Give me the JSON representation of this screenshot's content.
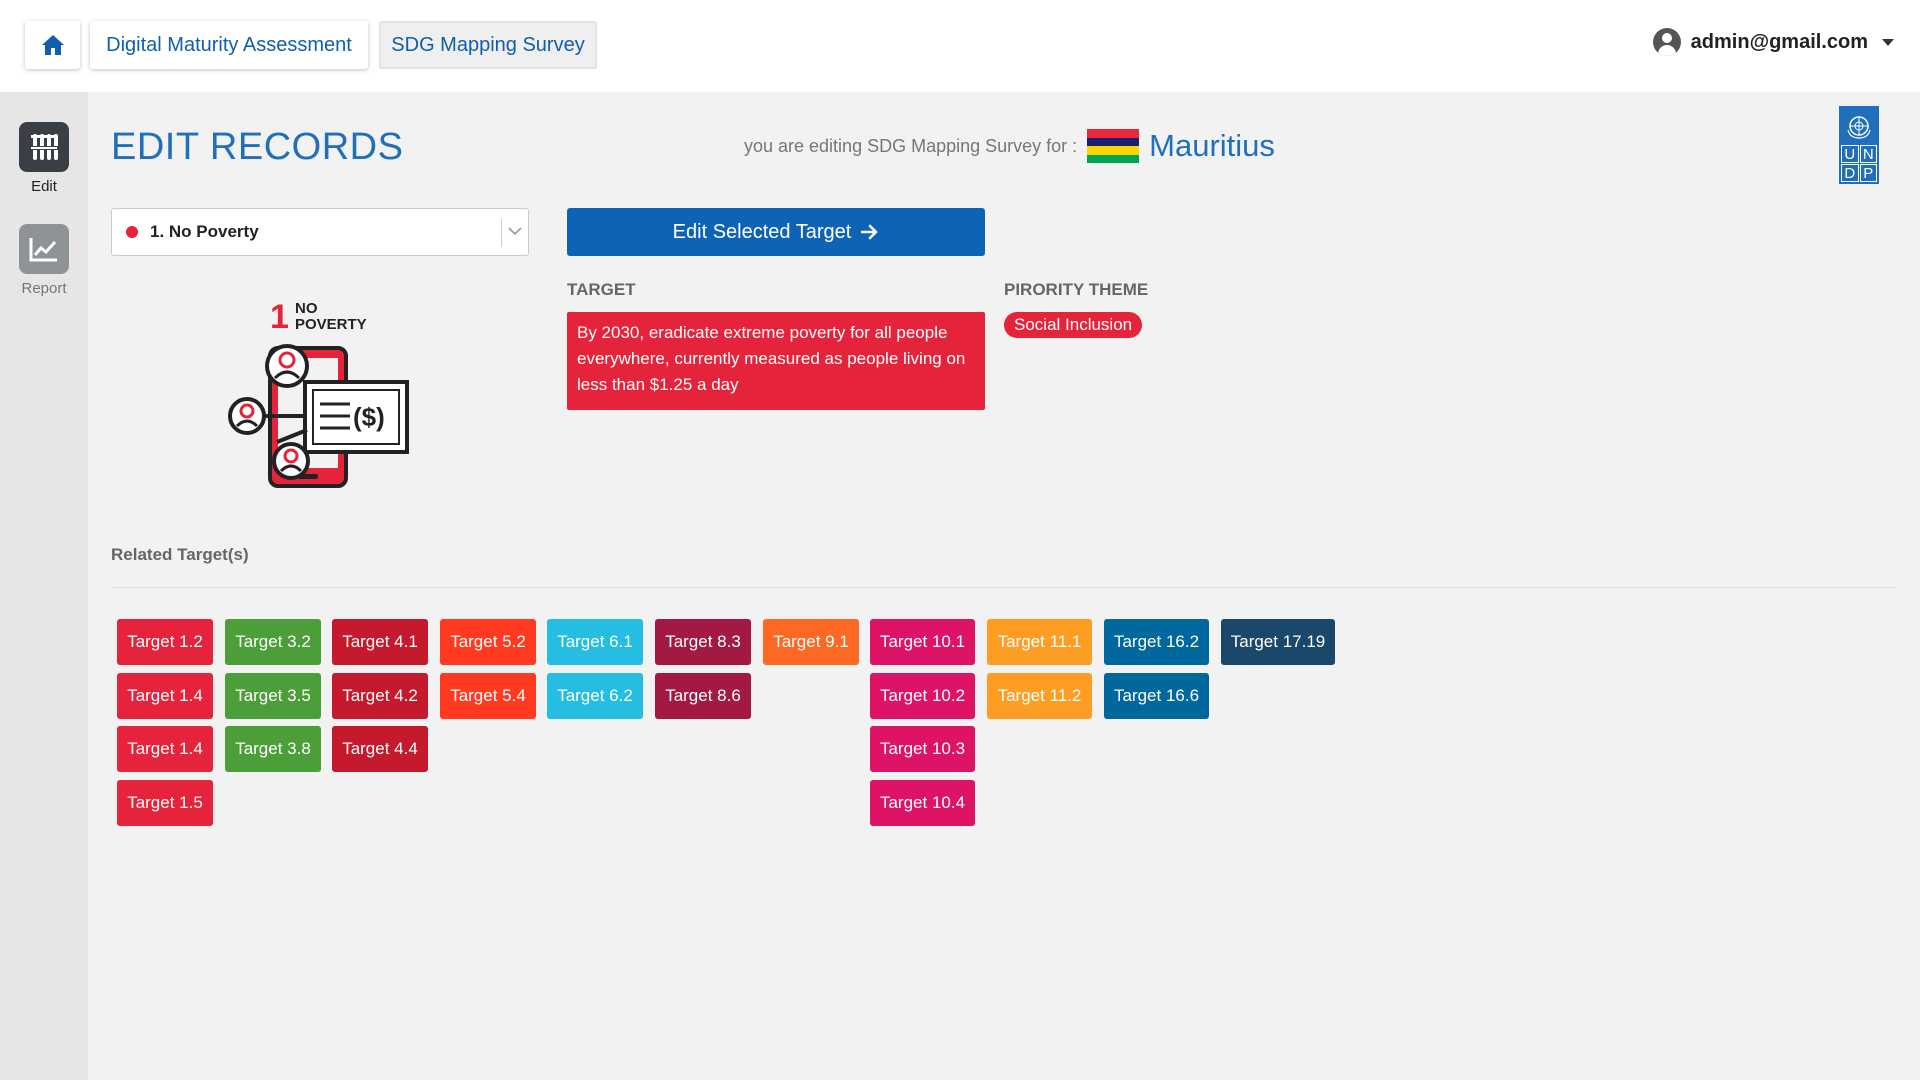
{
  "topbar": {
    "nav": [
      "Digital Maturity Assessment",
      "SDG Mapping Survey"
    ],
    "user": "admin@gmail.com"
  },
  "sidebar": {
    "items": [
      {
        "label": "Edit",
        "icon": "sliders-icon"
      },
      {
        "label": "Report",
        "icon": "chart-icon"
      }
    ]
  },
  "header": {
    "title": "EDIT RECORDS",
    "editing_label": "you are editing SDG Mapping Survey for :",
    "country": "Mauritius",
    "flag_colors": [
      "#EA2839",
      "#1A206D",
      "#FFD500",
      "#00A551"
    ],
    "undp_letters": [
      "U",
      "N",
      "D",
      "P"
    ]
  },
  "goal": {
    "selected": "1. No Poverty",
    "color": "#e5243b",
    "icon_number": "1",
    "icon_text_1": "NO",
    "icon_text_2": "POVERTY"
  },
  "actions": {
    "edit_button": "Edit Selected Target"
  },
  "target": {
    "label": "TARGET",
    "text": "By 2030, eradicate extreme poverty for all people everywhere, currently measured as people living on less than $1.25 a day"
  },
  "priority": {
    "label": "PIRORITY THEME",
    "value": "Social Inclusion"
  },
  "related": {
    "label": "Related Target(s)",
    "columns": [
      {
        "color": "#e5243b",
        "targets": [
          "Target 1.2",
          "Target 1.4",
          "Target 1.4",
          "Target 1.5"
        ]
      },
      {
        "color": "#4c9f38",
        "targets": [
          "Target 3.2",
          "Target 3.5",
          "Target 3.8"
        ]
      },
      {
        "color": "#c5192d",
        "targets": [
          "Target 4.1",
          "Target 4.2",
          "Target 4.4"
        ]
      },
      {
        "color": "#ff3a21",
        "targets": [
          "Target 5.2",
          "Target 5.4"
        ]
      },
      {
        "color": "#26bde2",
        "targets": [
          "Target 6.1",
          "Target 6.2"
        ]
      },
      {
        "color": "#a21942",
        "targets": [
          "Target 8.3",
          "Target 8.6"
        ]
      },
      {
        "color": "#fd6925",
        "targets": [
          "Target 9.1"
        ]
      },
      {
        "color": "#dd1367",
        "targets": [
          "Target 10.1",
          "Target 10.2",
          "Target 10.3",
          "Target 10.4"
        ]
      },
      {
        "color": "#fd9d24",
        "targets": [
          "Target 11.1",
          "Target 11.2"
        ]
      },
      {
        "color": "#00689d",
        "targets": [
          "Target 16.2",
          "Target 16.6"
        ]
      },
      {
        "color": "#19486a",
        "targets": [
          "Target 17.19"
        ]
      }
    ]
  }
}
